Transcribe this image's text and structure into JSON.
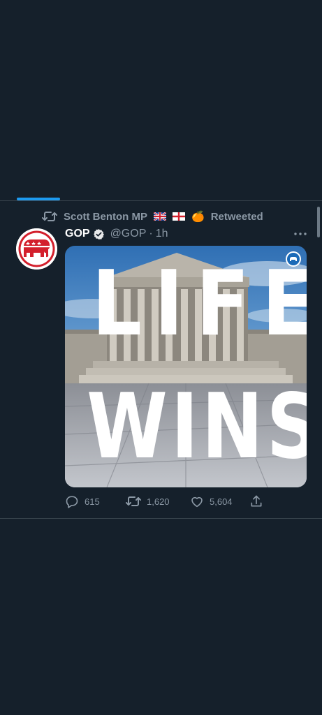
{
  "social_context": {
    "retweeter": "Scott Benton MP",
    "retweeter_emoji": "🍊",
    "retweeted_label": "Retweeted"
  },
  "tweet": {
    "author_name": "GOP",
    "handle": "@GOP",
    "separator": "·",
    "time": "1h",
    "media": {
      "line1": "LIFE",
      "line2": "WINS"
    },
    "reply_count": "615",
    "retweet_count": "1,620",
    "like_count": "5,604"
  },
  "colors": {
    "background": "#15202b",
    "accent": "#1d9bf0",
    "secondary_text": "#8b98a5",
    "divider": "#38444d",
    "gop_red": "#d31f2c"
  },
  "icons": {
    "retweet": "retweet-icon",
    "verified": "verified-badge-icon",
    "more": "more-dots-icon",
    "reply": "reply-icon",
    "like": "heart-icon",
    "share": "share-icon"
  }
}
